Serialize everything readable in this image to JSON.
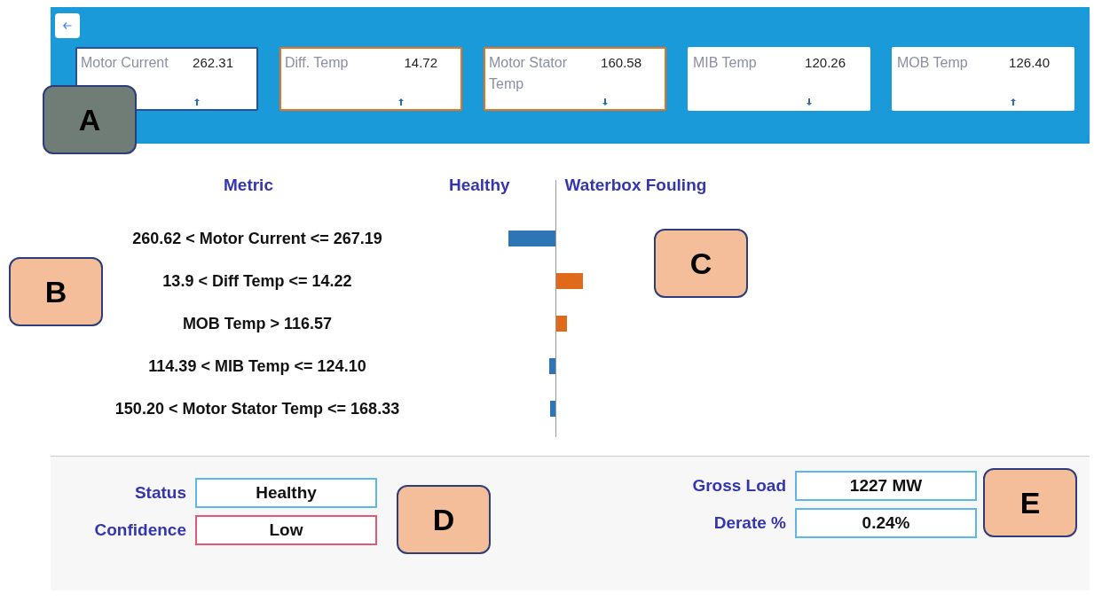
{
  "cards": [
    {
      "label": "Motor Current",
      "value": "262.31",
      "color": "#2a4f9e",
      "rising": true
    },
    {
      "label": "Diff. Temp",
      "value": "14.72",
      "color": "#e8741e",
      "rising": true
    },
    {
      "label": "Motor Stator Temp",
      "value": "160.58",
      "color": "#e8741e",
      "rising": false
    },
    {
      "label": "MIB Temp",
      "value": "120.26",
      "color": "#ffffff",
      "rising": false
    },
    {
      "label": "MOB Temp",
      "value": "126.40",
      "color": "#ffffff",
      "rising": true
    }
  ],
  "chart": {
    "metric_heading": "Metric",
    "left_heading": "Healthy",
    "right_heading": "Waterbox Fouling",
    "rows": [
      {
        "label": "260.62 < Motor Current <= 267.19",
        "kind": "healthy"
      },
      {
        "label": "13.9 < Diff Temp <= 14.22",
        "kind": "fouling"
      },
      {
        "label": "MOB Temp > 116.57",
        "kind": "fouling"
      },
      {
        "label": "114.39 < MIB Temp <= 124.10",
        "kind": "healthy"
      },
      {
        "label": "150.20 < Motor Stator Temp <= 168.33",
        "kind": "healthy"
      }
    ]
  },
  "summary": {
    "left": [
      {
        "label": "Status",
        "value": "Healthy",
        "color": "#5bb8e8"
      },
      {
        "label": "Confidence",
        "value": "Low",
        "color": "#e05a78"
      }
    ],
    "right": [
      {
        "label": "Gross Load",
        "value": "1227 MW",
        "color": "#5bb8e8"
      },
      {
        "label": "Derate %",
        "value": "0.24%",
        "color": "#5bb8e8"
      }
    ]
  },
  "callouts": [
    "A",
    "B",
    "C",
    "D",
    "E"
  ]
}
